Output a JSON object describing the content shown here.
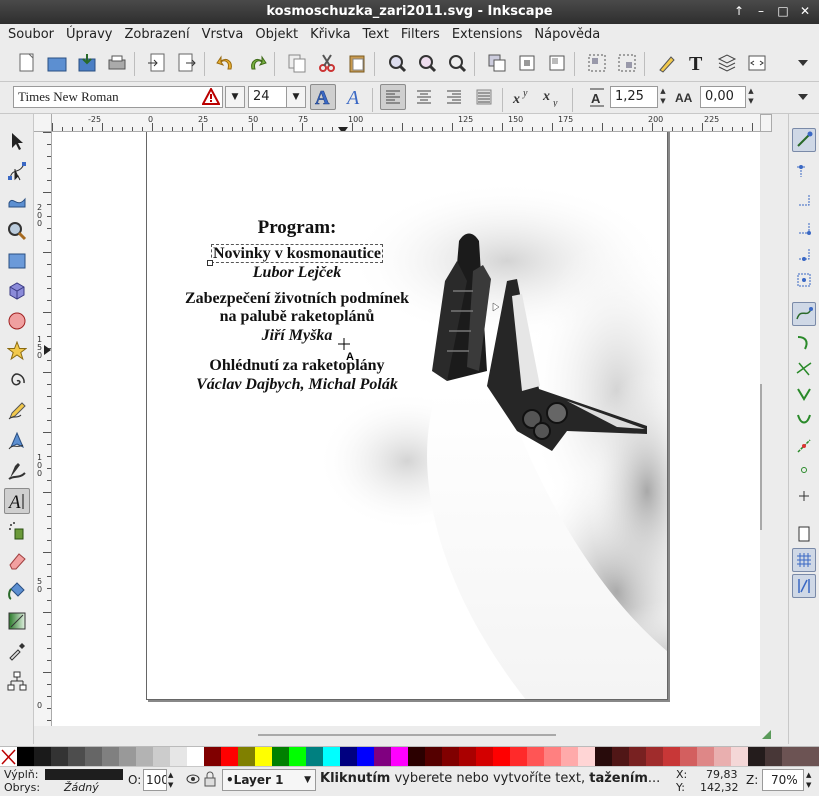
{
  "window": {
    "title": "kosmoschuzka_zari2011.svg - Inkscape"
  },
  "menu": [
    "Soubor",
    "Úpravy",
    "Zobrazení",
    "Vrstva",
    "Objekt",
    "Křivka",
    "Text",
    "Filters",
    "Extensions",
    "Nápověda"
  ],
  "textbar": {
    "font_family": "Times New Roman",
    "font_size": "24",
    "line_spacing": "1,25",
    "letter_spacing": "0,00"
  },
  "ruler": {
    "h_labels": [
      "-25",
      "0",
      "25",
      "50",
      "75",
      "100",
      "125",
      "150",
      "175",
      "200",
      "225"
    ],
    "v_labels": [
      "2\n0\n0",
      "1\n5\n0",
      "1\n0\n0",
      "5\n0",
      "0"
    ]
  },
  "document": {
    "program_heading": "Program:",
    "talks": [
      {
        "title": "Novinky v kosmonautice",
        "speaker": "Lubor Lejček"
      },
      {
        "title": "Zabezpečení životních podmínek",
        "title2": "na palubě raketoplánů",
        "speaker": "Jiří Myška"
      },
      {
        "title": "Ohlédnutí za raketoplány",
        "speaker": "Václav Dajbych, Michal Polák"
      }
    ]
  },
  "palette": [
    "#000000",
    "#1a1a1a",
    "#333333",
    "#4d4d4d",
    "#666666",
    "#808080",
    "#999999",
    "#b3b3b3",
    "#cccccc",
    "#e6e6e6",
    "#ffffff",
    "#800000",
    "#ff0000",
    "#808000",
    "#ffff00",
    "#008000",
    "#00ff00",
    "#008080",
    "#00ffff",
    "#000080",
    "#0000ff",
    "#800080",
    "#ff00ff",
    "#2b0000",
    "#550000",
    "#800000",
    "#aa0000",
    "#d40000",
    "#ff0000",
    "#ff2a2a",
    "#ff5555",
    "#ff8080",
    "#ffaaaa",
    "#ffd5d5",
    "#280b0b",
    "#501616",
    "#782121",
    "#a02c2c",
    "#c83737",
    "#d35f5f",
    "#de8787",
    "#e9afaf",
    "#f4d7d7",
    "#241c1c",
    "#483737",
    "#6c5353"
  ],
  "status": {
    "fill_label": "Výplň:",
    "stroke_label": "Obrys:",
    "stroke_value": "Žádný",
    "opacity_label": "O:",
    "opacity_value": "100",
    "layer": "•Layer 1",
    "message_bold1": "Kliknutím",
    "message_mid": " vyberete nebo vytvoříte text, ",
    "message_bold2": "tažením",
    "message_end": "...",
    "x_label": "X:",
    "x_value": "79,83",
    "y_label": "Y:",
    "y_value": "142,32",
    "zoom_label": "Z:",
    "zoom_value": "70%"
  }
}
